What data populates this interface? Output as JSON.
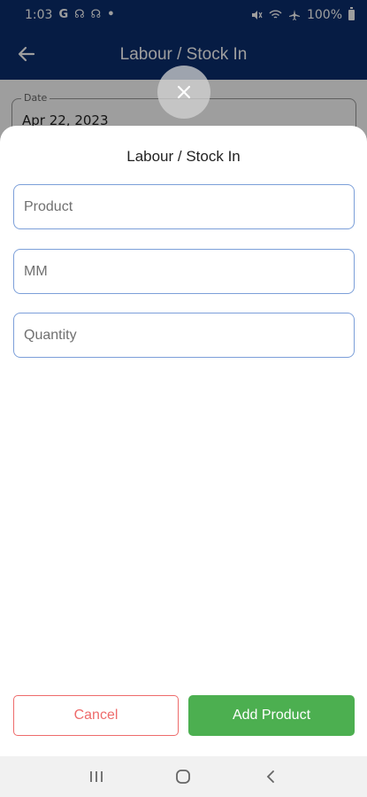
{
  "status_bar": {
    "time": "1:03",
    "left_icons": [
      "G",
      "☊",
      "☊",
      "•"
    ],
    "battery": "100%"
  },
  "app_bar": {
    "title": "Labour / Stock In"
  },
  "background_form": {
    "date_label": "Date",
    "date_value": "Apr 22, 2023"
  },
  "sheet": {
    "title": "Labour / Stock In",
    "fields": {
      "product_placeholder": "Product",
      "mm_placeholder": "MM",
      "quantity_placeholder": "Quantity"
    },
    "cancel_label": "Cancel",
    "add_label": "Add Product"
  },
  "colors": {
    "app_bar": "#0a2e6e",
    "field_border": "#7c9fd9",
    "cancel": "#ee6b6b",
    "add": "#4caf50"
  }
}
